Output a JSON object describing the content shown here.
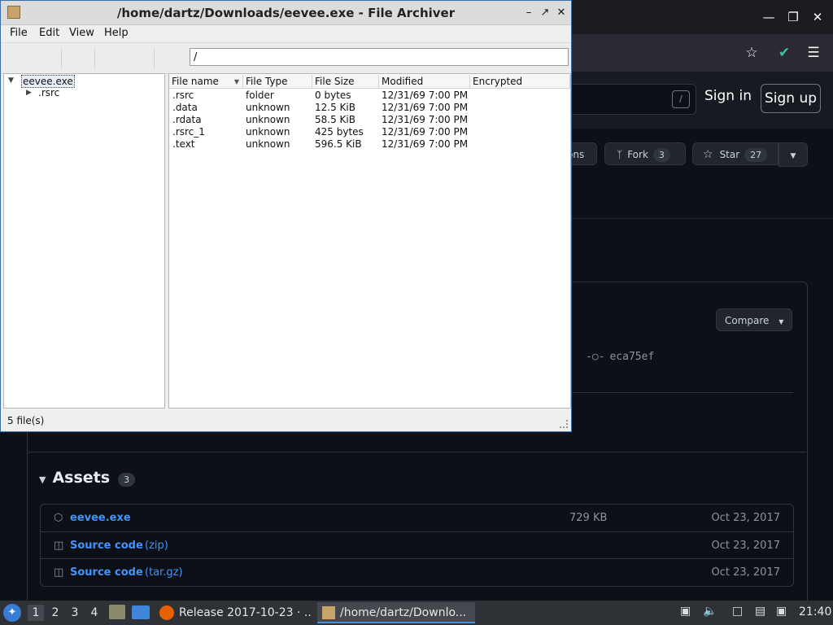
{
  "browser": {
    "github": {
      "sign_in": "Sign in",
      "sign_up": "Sign up",
      "search_slash": "/",
      "notifications_partial": "ons",
      "fork_label": "Fork",
      "fork_count": "3",
      "star_label": "Star",
      "star_count": "27",
      "compare_label": "Compare",
      "commit": "eca75ef",
      "assets_title": "Assets",
      "assets_count": "3",
      "assets": [
        {
          "name": "eevee.exe",
          "ext": "",
          "size": "729 KB",
          "date": "Oct 23, 2017",
          "icon": "package-icon"
        },
        {
          "name": "Source code",
          "ext": "(zip)",
          "size": "",
          "date": "Oct 23, 2017",
          "icon": "file-zip-icon"
        },
        {
          "name": "Source code",
          "ext": "(tar.gz)",
          "size": "",
          "date": "Oct 23, 2017",
          "icon": "file-zip-icon"
        }
      ]
    }
  },
  "archiver": {
    "title": "/home/dartz/Downloads/eevee.exe - File Archiver",
    "menu": {
      "file": "File",
      "edit": "Edit",
      "view": "View",
      "help": "Help"
    },
    "path": "/",
    "tree": {
      "root": "eevee.exe",
      "child": ".rsrc"
    },
    "columns": {
      "name": "File name",
      "type": "File Type",
      "size": "File Size",
      "modified": "Modified",
      "encrypted": "Encrypted"
    },
    "files": [
      {
        "name": ".rsrc",
        "type": "folder",
        "size": "0 bytes",
        "modified": "12/31/69 7:00 PM",
        "encrypted": ""
      },
      {
        "name": ".data",
        "type": "unknown",
        "size": "12.5 KiB",
        "modified": "12/31/69 7:00 PM",
        "encrypted": ""
      },
      {
        "name": ".rdata",
        "type": "unknown",
        "size": "58.5 KiB",
        "modified": "12/31/69 7:00 PM",
        "encrypted": ""
      },
      {
        "name": ".rsrc_1",
        "type": "unknown",
        "size": "425 bytes",
        "modified": "12/31/69 7:00 PM",
        "encrypted": ""
      },
      {
        "name": ".text",
        "type": "unknown",
        "size": "596.5 KiB",
        "modified": "12/31/69 7:00 PM",
        "encrypted": ""
      }
    ],
    "status": "5 file(s)"
  },
  "taskbar": {
    "workspaces": [
      "1",
      "2",
      "3",
      "4"
    ],
    "apps": [
      {
        "label": "Release 2017-10-23 · ...",
        "active": false
      },
      {
        "label": "/home/dartz/Downlo...",
        "active": true
      }
    ],
    "clock": "21:40"
  }
}
